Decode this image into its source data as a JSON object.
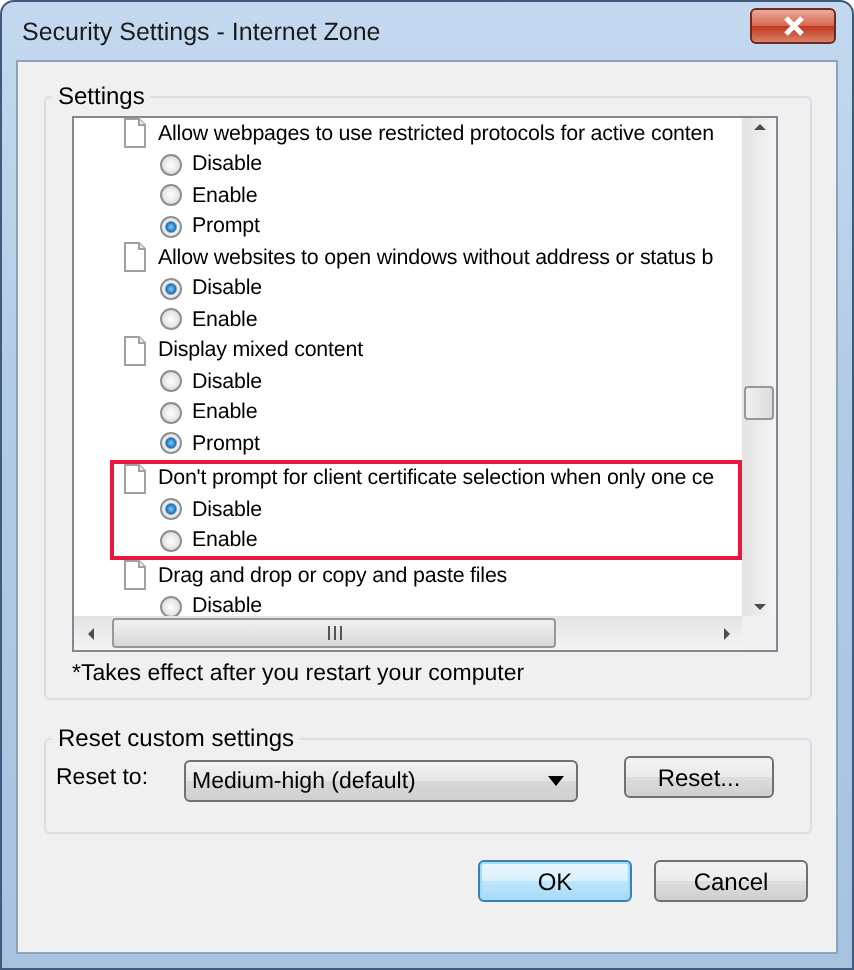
{
  "window": {
    "title": "Security Settings - Internet Zone"
  },
  "settings": {
    "legend": "Settings",
    "sections": [
      {
        "label": "Allow webpages to use restricted protocols for active conten",
        "highlighted": false,
        "options": [
          {
            "label": "Disable",
            "selected": false
          },
          {
            "label": "Enable",
            "selected": false
          },
          {
            "label": "Prompt",
            "selected": true
          }
        ]
      },
      {
        "label": "Allow websites to open windows without address or status b",
        "highlighted": false,
        "options": [
          {
            "label": "Disable",
            "selected": true
          },
          {
            "label": "Enable",
            "selected": false
          }
        ]
      },
      {
        "label": "Display mixed content",
        "highlighted": false,
        "options": [
          {
            "label": "Disable",
            "selected": false
          },
          {
            "label": "Enable",
            "selected": false
          },
          {
            "label": "Prompt",
            "selected": true
          }
        ]
      },
      {
        "label": "Don't prompt for client certificate selection when only one ce",
        "highlighted": true,
        "options": [
          {
            "label": "Disable",
            "selected": true
          },
          {
            "label": "Enable",
            "selected": false
          }
        ]
      },
      {
        "label": "Drag and drop or copy and paste files",
        "highlighted": false,
        "options": [
          {
            "label": "Disable",
            "selected": false
          }
        ]
      }
    ],
    "note": "*Takes effect after you restart your computer"
  },
  "reset": {
    "legend": "Reset custom settings",
    "label": "Reset to:",
    "dropdown": {
      "value": "Medium-high (default)"
    },
    "button": "Reset..."
  },
  "buttons": [
    {
      "label": "OK",
      "default": true
    },
    {
      "label": "Cancel",
      "default": false
    }
  ]
}
